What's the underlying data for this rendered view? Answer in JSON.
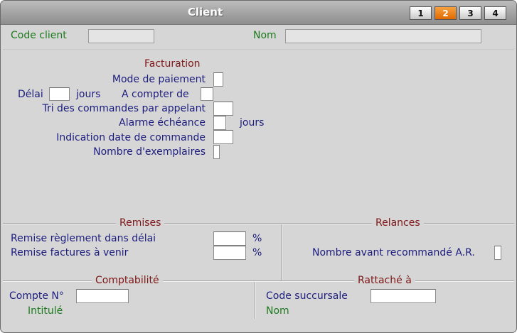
{
  "window": {
    "title": "Client"
  },
  "tabs": [
    "1",
    "2",
    "3",
    "4"
  ],
  "active_tab": "2",
  "header": {
    "code_client_label": "Code client",
    "code_client_value": "",
    "nom_label": "Nom",
    "nom_value": ""
  },
  "facturation": {
    "title": "Facturation",
    "mode_paiement_label": "Mode de paiement",
    "delai_label": "Délai",
    "jours_label": "jours",
    "a_compter_label": "A compter de",
    "tri_label": "Tri des commandes par appelant",
    "alarme_label": "Alarme échéance",
    "alarme_jours_label": "jours",
    "indication_label": "Indication date de commande",
    "exemplaires_label": "Nombre d'exemplaires"
  },
  "remises": {
    "title": "Remises",
    "reglement_label": "Remise règlement dans délai",
    "reglement_unit": "%",
    "factures_label": "Remise factures à venir",
    "factures_unit": "%"
  },
  "relances": {
    "title": "Relances",
    "recommande_label": "Nombre avant recommandé A.R."
  },
  "comptabilite": {
    "title": "Comptabilité",
    "compte_label": "Compte N°",
    "intitule_label": "Intitulé"
  },
  "rattache": {
    "title": "Rattaché à",
    "succursale_label": "Code succursale",
    "nom_label": "Nom"
  },
  "colors": {
    "label_blue": "#1c1c7e",
    "label_green": "#1d7a1d",
    "section_red": "#7e1616",
    "active_tab": "#e06a00"
  }
}
